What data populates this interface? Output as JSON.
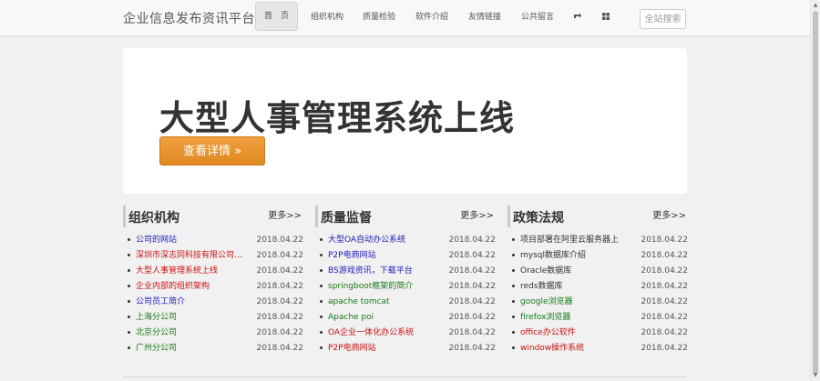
{
  "nav": {
    "brand": "企业信息发布资讯平台",
    "items": [
      "首　页",
      "组织机构",
      "质量检验",
      "软件介绍",
      "友情链接",
      "公共留言"
    ],
    "search_label": "全站搜索"
  },
  "hero": {
    "title": "大型人事管理系统上线",
    "button_label": "查看详情 »"
  },
  "colors": {
    "blue": "#1a1ab8",
    "red": "#cc1010",
    "green": "#157a15",
    "orange": "#e68a22"
  },
  "columns": [
    {
      "title": "组织机构",
      "more": "更多>>",
      "items": [
        {
          "text": "公司的网站",
          "date": "2018.04.22",
          "color": "#1a1ab8"
        },
        {
          "text": "深圳市深志同科技有限公司网站",
          "date": "2018.04.22",
          "color": "#cc1010"
        },
        {
          "text": "大型人事管理系统上线",
          "date": "2018.04.22",
          "color": "#cc1010"
        },
        {
          "text": "企业内部的组织架构",
          "date": "2018.04.22",
          "color": "#cc1010"
        },
        {
          "text": "公司员工简介",
          "date": "2018.04.22",
          "color": "#1a1ab8"
        },
        {
          "text": "上海分公司",
          "date": "2018.04.22",
          "color": "#157a15"
        },
        {
          "text": "北京分公司",
          "date": "2018.04.22",
          "color": "#157a15"
        },
        {
          "text": "广州分公司",
          "date": "2018.04.22",
          "color": "#157a15"
        }
      ]
    },
    {
      "title": "质量监督",
      "more": "更多>>",
      "items": [
        {
          "text": "大型OA自动办公系统",
          "date": "2018.04.22",
          "color": "#1a1ab8"
        },
        {
          "text": "P2P电商网站",
          "date": "2018.04.22",
          "color": "#1a1ab8"
        },
        {
          "text": "BS游戏资讯，下载平台",
          "date": "2018.04.22",
          "color": "#1a1ab8"
        },
        {
          "text": "springboot框架的简介",
          "date": "2018.04.22",
          "color": "#157a15"
        },
        {
          "text": "apache tomcat",
          "date": "2018.04.22",
          "color": "#157a15"
        },
        {
          "text": "Apache poi",
          "date": "2018.04.22",
          "color": "#157a15"
        },
        {
          "text": "OA企业一体化办公系统",
          "date": "2018.04.22",
          "color": "#cc1010"
        },
        {
          "text": "P2P电商网站",
          "date": "2018.04.22",
          "color": "#cc1010"
        }
      ]
    },
    {
      "title": "政策法规",
      "more": "更多>>",
      "items": [
        {
          "text": "项目部署在阿里云服务器上",
          "date": "2018.04.22",
          "color": "#333333"
        },
        {
          "text": "mysql数据库介绍",
          "date": "2018.04.22",
          "color": "#333333"
        },
        {
          "text": "Oracle数据库",
          "date": "2018.04.22",
          "color": "#333333"
        },
        {
          "text": "reds数据库",
          "date": "2018.04.22",
          "color": "#333333"
        },
        {
          "text": "google浏览器",
          "date": "2018.04.22",
          "color": "#157a15"
        },
        {
          "text": "firefox浏览器",
          "date": "2018.04.22",
          "color": "#157a15"
        },
        {
          "text": "office办公软件",
          "date": "2018.04.22",
          "color": "#cc1010"
        },
        {
          "text": "window操作系统",
          "date": "2018.04.22",
          "color": "#cc1010"
        }
      ]
    }
  ]
}
